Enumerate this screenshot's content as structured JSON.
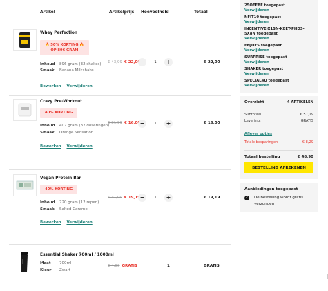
{
  "table": {
    "col_article": "Artikel",
    "col_price": "Artikelprijs",
    "col_qty": "Hoeveelheid",
    "col_total": "Totaal"
  },
  "items": [
    {
      "name": "Whey Perfection",
      "badge_line1": "🔥 50% KORTING 🔥",
      "badge_line2": "OP 896 GRAM",
      "content_label": "Inhoud",
      "content_value": "896 gram (32 shakes)",
      "taste_label": "Smaak",
      "taste_value": "Banana Milkshake",
      "edit": "Bewerken",
      "remove": "Verwijderen",
      "old_price": "€ 43,99",
      "new_price": "€ 22,00",
      "qty": "1",
      "total": "€ 22,00",
      "icon": "whey-pouch-icon"
    },
    {
      "name": "Crazy Pre-Workout",
      "badge_line1": "40% KORTING",
      "content_label": "Inhoud",
      "content_value": "407 gram (37 doseringen)",
      "taste_label": "Smaak",
      "taste_value": "Orange Sensation",
      "edit": "Bewerken",
      "remove": "Verwijderen",
      "old_price": "€ 31,99",
      "new_price": "€ 16,00",
      "qty": "1",
      "total": "€ 16,00",
      "icon": "preworkout-pouch-icon"
    },
    {
      "name": "Vegan Protein Bar",
      "badge_line1": "40% KORTING",
      "content_label": "Inhoud",
      "content_value": "720 gram (12 repen)",
      "taste_label": "Smaak",
      "taste_value": "Salted Caramel",
      "edit": "Bewerken",
      "remove": "Verwijderen",
      "old_price": "€ 31,99",
      "new_price": "€ 19,19",
      "qty": "1",
      "total": "€ 19,19",
      "icon": "protein-bar-box-icon"
    },
    {
      "name": "Essential Shaker 700ml / 1000ml",
      "size_label": "Maat",
      "size_value": "700ml",
      "color_label": "Kleur",
      "color_value": "Zwart",
      "old_price": "€ 4,00",
      "new_price": "GRATIS",
      "qty": "1",
      "total": "GRATIS",
      "icon": "shaker-icon"
    }
  ],
  "coupons": [
    {
      "code": "25OFFBF toegepast",
      "remove": "Verwijderen"
    },
    {
      "code": "NFIT10 toegepast",
      "remove": "Verwijderen"
    },
    {
      "code": "INCENTIVE-X1SN-KEET-PHDS-5X8N toegepast",
      "remove": "Verwijderen"
    },
    {
      "code": "ENJOYS toegepast",
      "remove": "Verwijderen"
    },
    {
      "code": "SURPRISE toegepast",
      "remove": "Verwijderen"
    },
    {
      "code": "SHAKER toegepast",
      "remove": "Verwijderen"
    },
    {
      "code": "SPECIAL4U toegepast",
      "remove": "Verwijderen"
    }
  ],
  "overview": {
    "title": "Overzicht",
    "count": "4 ARTIKELEN",
    "subtotal_label": "Subtotaal",
    "subtotal_value": "€ 57,19",
    "delivery_label": "Levering:",
    "delivery_value": "GRATIS",
    "delivery_options": "Aflever opties",
    "savings_label": "Totale besparingen",
    "savings_value": "- € 8,29",
    "total_label": "Totaal bestelling",
    "total_value": "€ 48,90",
    "checkout": "BESTELLING AFREKENEN"
  },
  "offers": {
    "title": "Aanbiedingen toegepast",
    "item": "De bestelling wordt gratis verzonden"
  },
  "colors": {
    "accent_red": "#e8342b",
    "link_teal": "#1e8078",
    "checkout_yellow": "#ffe600"
  }
}
